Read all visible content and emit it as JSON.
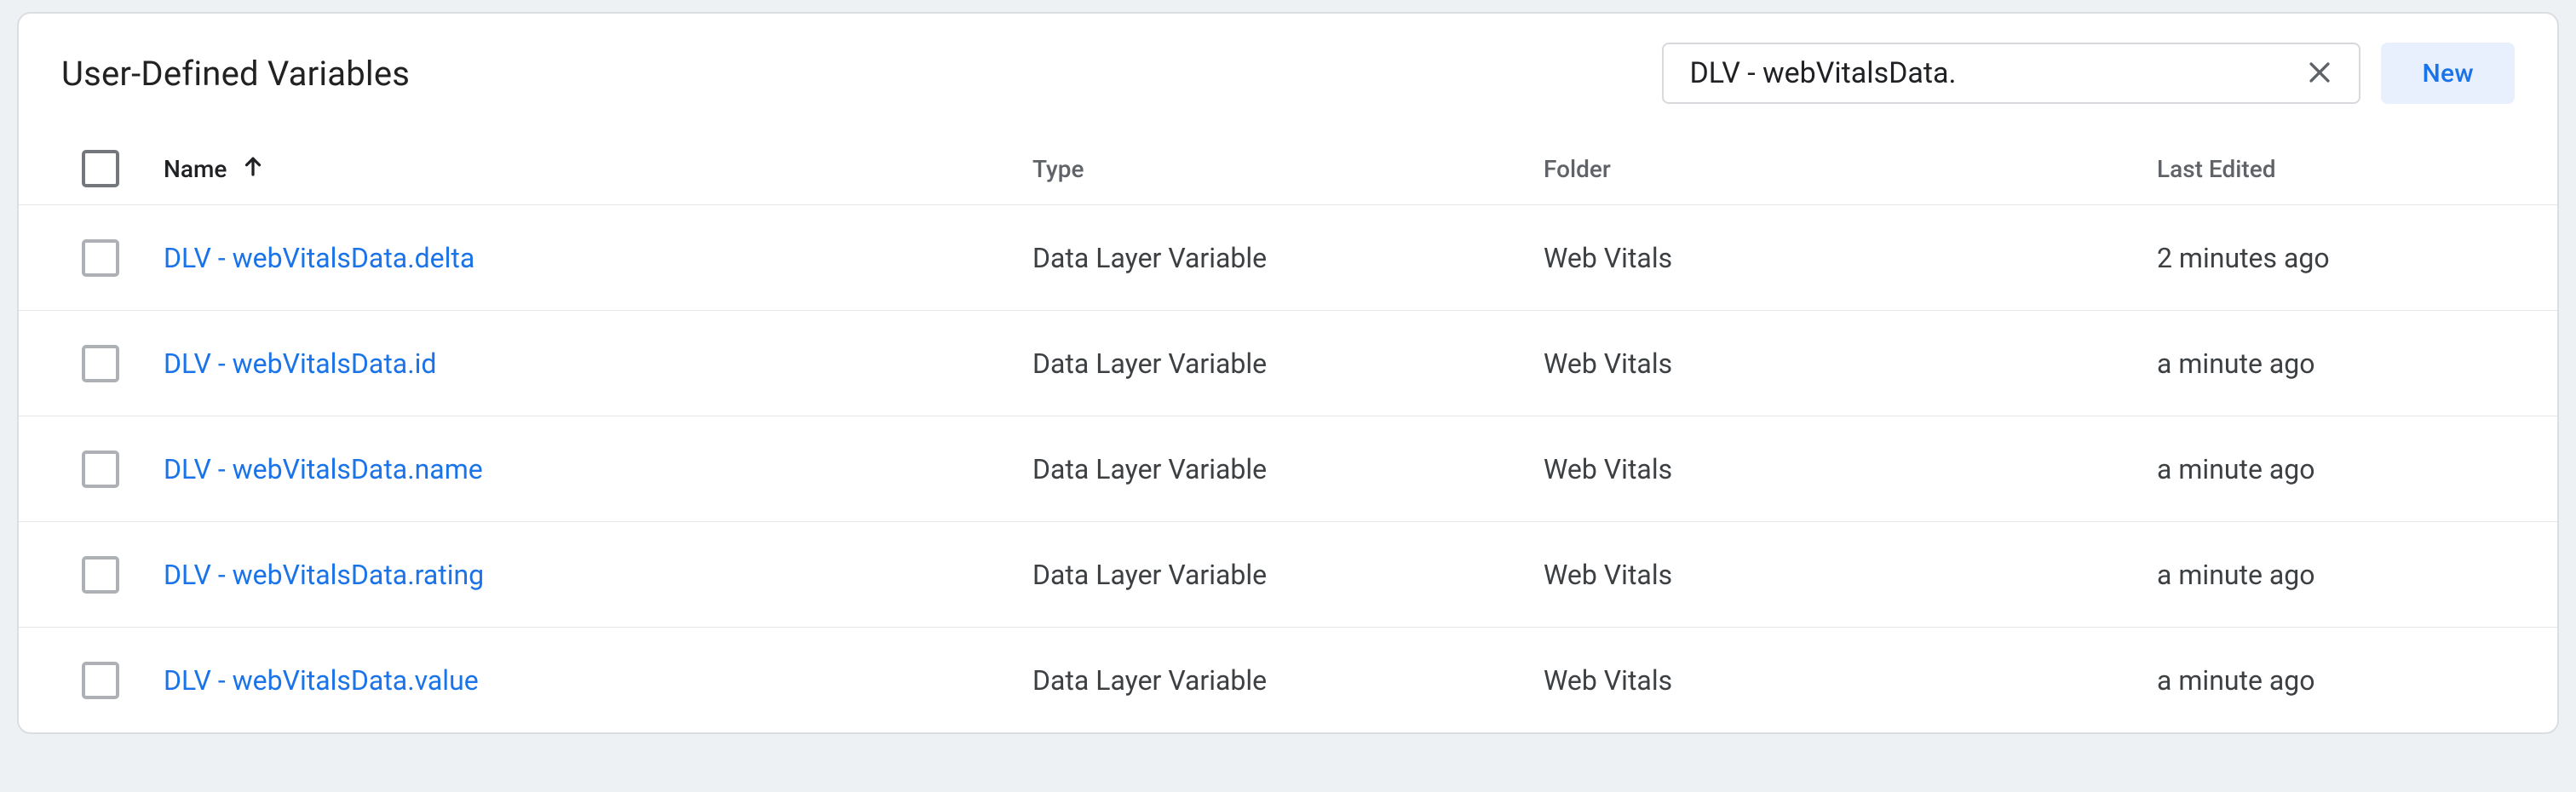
{
  "panel": {
    "title": "User-Defined Variables",
    "new_button_label": "New"
  },
  "search": {
    "value": "DLV - webVitalsData."
  },
  "columns": {
    "name": "Name",
    "type": "Type",
    "folder": "Folder",
    "last_edited": "Last Edited"
  },
  "rows": [
    {
      "name": "DLV - webVitalsData.delta",
      "type": "Data Layer Variable",
      "folder": "Web Vitals",
      "last_edited": "2 minutes ago"
    },
    {
      "name": "DLV - webVitalsData.id",
      "type": "Data Layer Variable",
      "folder": "Web Vitals",
      "last_edited": "a minute ago"
    },
    {
      "name": "DLV - webVitalsData.name",
      "type": "Data Layer Variable",
      "folder": "Web Vitals",
      "last_edited": "a minute ago"
    },
    {
      "name": "DLV - webVitalsData.rating",
      "type": "Data Layer Variable",
      "folder": "Web Vitals",
      "last_edited": "a minute ago"
    },
    {
      "name": "DLV - webVitalsData.value",
      "type": "Data Layer Variable",
      "folder": "Web Vitals",
      "last_edited": "a minute ago"
    }
  ]
}
